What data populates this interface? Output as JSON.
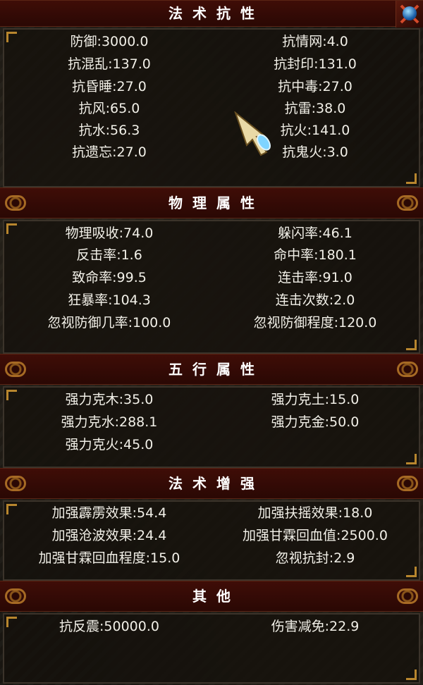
{
  "sections": [
    {
      "title": "法术抗性",
      "rows": [
        [
          "防御:3000.0",
          "抗情网:4.0"
        ],
        [
          "抗混乱:137.0",
          "抗封印:131.0"
        ],
        [
          "抗昏睡:27.0",
          "抗中毒:27.0"
        ],
        [
          "抗风:65.0",
          "抗雷:38.0"
        ],
        [
          "抗水:56.3",
          "抗火:141.0"
        ],
        [
          "抗遗忘:27.0",
          "抗鬼火:3.0"
        ]
      ]
    },
    {
      "title": "物理属性",
      "rows": [
        [
          "物理吸收:74.0",
          "躲闪率:46.1"
        ],
        [
          "反击率:1.6",
          "命中率:180.1"
        ],
        [
          "致命率:99.5",
          "连击率:91.0"
        ],
        [
          "狂暴率:104.3",
          "连击次数:2.0"
        ],
        [
          "忽视防御几率:100.0",
          "忽视防御程度:120.0"
        ]
      ]
    },
    {
      "title": "五行属性",
      "rows": [
        [
          "强力克木:35.0",
          "强力克土:15.0"
        ],
        [
          "强力克水:288.1",
          "强力克金:50.0"
        ],
        [
          "强力克火:45.0",
          ""
        ]
      ]
    },
    {
      "title": "法术增强",
      "rows": [
        [
          "加强霹雳效果:54.4",
          "加强扶摇效果:18.0"
        ],
        [
          "加强沧波效果:24.4",
          "加强甘霖回血值:2500.0"
        ],
        [
          "加强甘霖回血程度:15.0",
          "忽视抗封:2.9"
        ]
      ]
    },
    {
      "title": "其他",
      "rows": [
        [
          "抗反震:50000.0",
          "伤害减免:22.9"
        ]
      ]
    }
  ],
  "icons": {
    "top_right": "skill-icon",
    "cursor": "arrow-cursor-icon",
    "header_ornament": "scroll-ornament-icon"
  },
  "colors": {
    "header_bg": "#3a0b06",
    "text": "#f2f0e8",
    "ornament": "#b8782c"
  }
}
